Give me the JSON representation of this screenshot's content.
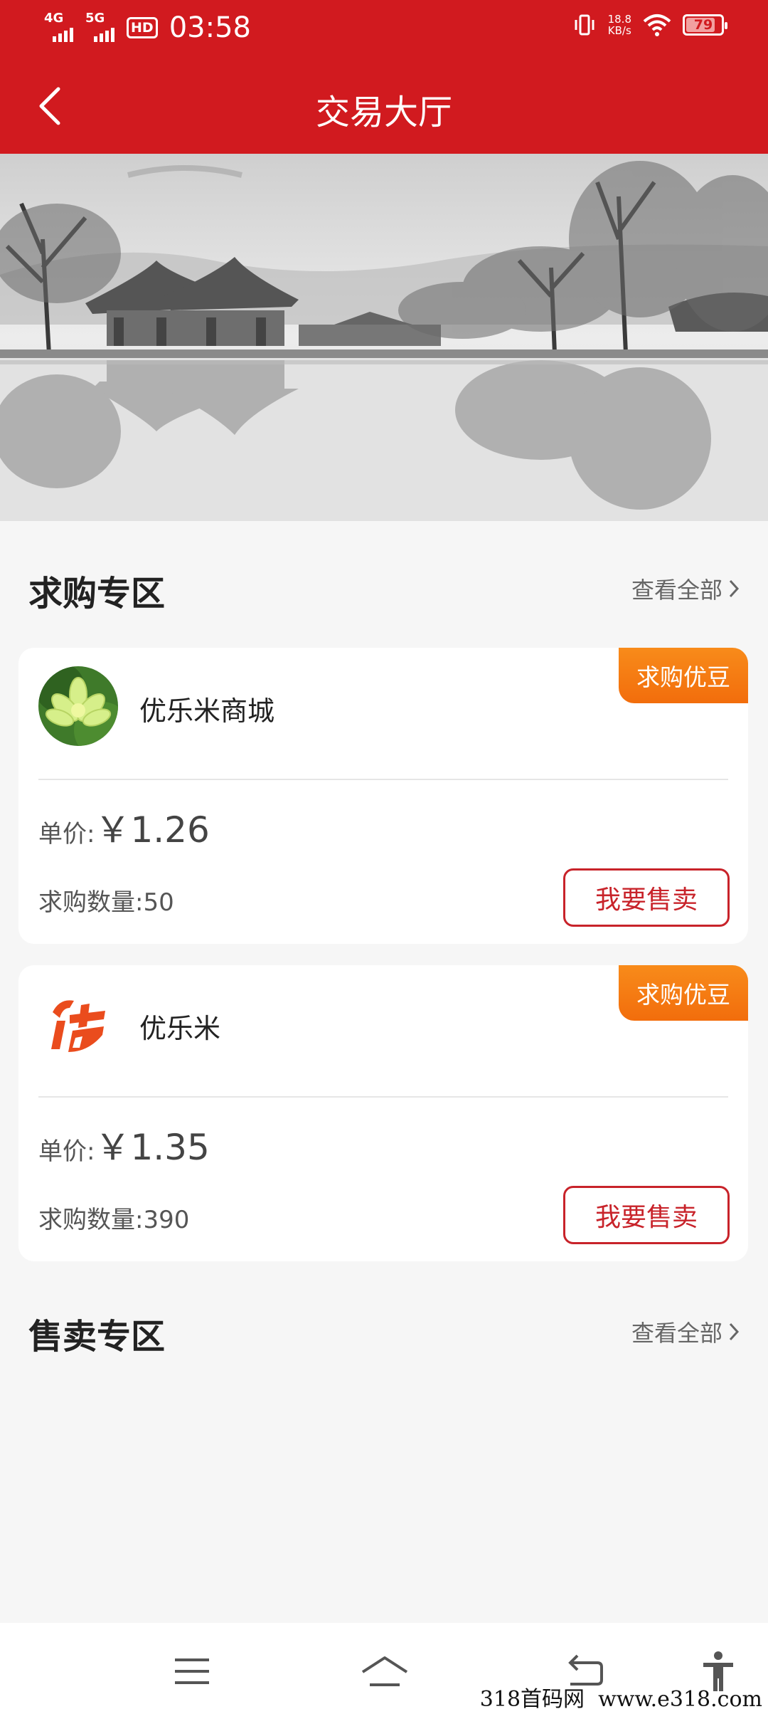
{
  "status_bar": {
    "network_1": "4G",
    "network_2": "5G",
    "hd_badge": "HD",
    "time": "03:58",
    "speed_value": "18.8",
    "speed_unit": "KB/s",
    "battery": "79"
  },
  "header": {
    "title": "交易大厅",
    "background_color": "#d11a1f"
  },
  "buy_section": {
    "title": "求购专区",
    "view_all": "查看全部",
    "cards": [
      {
        "tag": "求购优豆",
        "shop_name": "优乐米商城",
        "price_label": "单价:",
        "price_value": "￥1.26",
        "quantity_text": "求购数量:50",
        "action": "我要售卖"
      },
      {
        "tag": "求购优豆",
        "shop_name": "优乐米",
        "price_label": "单价:",
        "price_value": "￥1.35",
        "quantity_text": "求购数量:390",
        "action": "我要售卖"
      }
    ]
  },
  "sell_section": {
    "title": "售卖专区",
    "view_all": "查看全部"
  },
  "watermark": "318首码网  www.e318.com",
  "colors": {
    "accent_red": "#d11a1f",
    "tag_orange": "#f47a12",
    "button_border": "#c8232a"
  },
  "icons": [
    "back-arrow-icon",
    "vibrate-icon",
    "wifi-icon",
    "battery-icon",
    "chevron-right-icon",
    "menu-icon",
    "home-icon",
    "back-icon",
    "accessibility-icon"
  ]
}
